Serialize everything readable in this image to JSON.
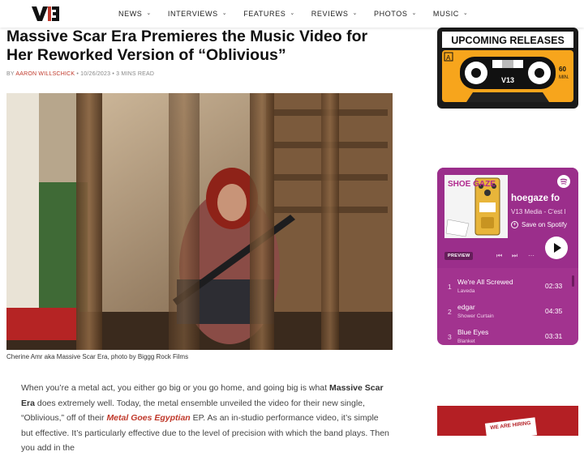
{
  "site": {
    "logo_alt": "V13"
  },
  "nav": [
    {
      "label": "NEWS"
    },
    {
      "label": "INTERVIEWS"
    },
    {
      "label": "FEATURES"
    },
    {
      "label": "REVIEWS"
    },
    {
      "label": "PHOTOS"
    },
    {
      "label": "MUSIC"
    }
  ],
  "article": {
    "title": "Massive Scar Era Premieres the Music Video for Her Reworked Version of “Oblivious”",
    "by": "BY",
    "author": "AARON WILLSCHICK",
    "date": "10/26/2023",
    "read_time": "3 MINS READ",
    "caption": "Cherine Amr aka Massive Scar Era, photo by Biggg Rock Films",
    "p1_a": "When you’re a metal act, you either go big or you go home, and going big is what ",
    "p1_band": "Massive Scar Era",
    "p1_b": " does extremely well. Today, the metal ensemble unveiled the video for their new single, “Oblivious,” off of their ",
    "p1_ep": "Metal Goes Egyptian",
    "p1_c": " EP. As an in-studio performance video, it’s simple but effective. It’s particularly effective due to the level of precision with which the band plays. Then you add in the"
  },
  "sidebar": {
    "upcoming": {
      "title": "UPCOMING RELEASES",
      "side": "A",
      "minutes": "60",
      "min_label": "MIN."
    },
    "spotify": {
      "cover_text": "SHOE GAZE",
      "playlist_title": "hoegaze fo",
      "subtitle": "V13 Media - C'est l",
      "save_label": "Save on Spotify",
      "preview_label": "PREVIEW",
      "tracks": [
        {
          "num": "1",
          "name": "We're All Screwed",
          "artist": "Laveda",
          "duration": "02:33"
        },
        {
          "num": "2",
          "name": "edgar",
          "artist": "Shower Curtain",
          "duration": "04:35"
        },
        {
          "num": "3",
          "name": "Blue Eyes",
          "artist": "Blanket",
          "duration": "03:31"
        }
      ]
    },
    "hiring": {
      "label": "WE ARE HIRING"
    }
  },
  "colors": {
    "accent": "#c0392b",
    "spotify_bg": "#a2338f",
    "cassette_orange": "#f7a51c"
  }
}
